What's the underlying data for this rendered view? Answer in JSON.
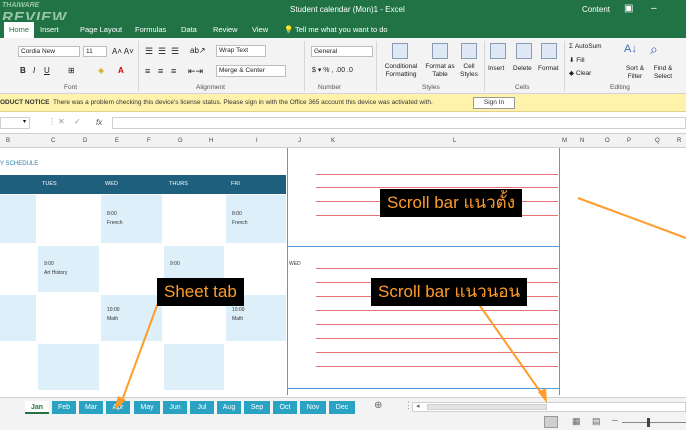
{
  "window": {
    "title": "Student calendar (Mon)1 - Excel",
    "content_label": "Content"
  },
  "watermark": {
    "line1": "THAIWARE",
    "line2": "REVIEW"
  },
  "ribbon_tabs": [
    "Home",
    "Insert",
    "Page Layout",
    "Formulas",
    "Data",
    "Review",
    "View"
  ],
  "tell_me": "Tell me what you want to do",
  "ribbon": {
    "font_name": "Cordia New",
    "font_size": "11",
    "wrap_text": "Wrap Text",
    "merge_center": "Merge & Center",
    "number_format": "General",
    "conditional_formatting": "Conditional Formatting",
    "format_as_table": "Format as Table",
    "cell_styles": "Cell Styles",
    "insert": "Insert",
    "delete": "Delete",
    "format": "Format",
    "autosum": "AutoSum",
    "fill": "Fill",
    "clear": "Clear",
    "sort_filter": "Sort & Filter",
    "find_select": "Find & Select",
    "groups": {
      "font": "Font",
      "alignment": "Alignment",
      "number": "Number",
      "styles": "Styles",
      "cells": "Cells",
      "editing": "Editing"
    }
  },
  "notice": {
    "title": "ODUCT NOTICE",
    "message": "There was a problem checking this device's license status. Please sign in with the Office 365 account this device was activated with.",
    "button": "Sign In"
  },
  "formula_bar": {
    "fx": "fx"
  },
  "columns": [
    "B",
    "C",
    "D",
    "E",
    "F",
    "G",
    "H",
    "I",
    "J",
    "K",
    "L",
    "M",
    "N",
    "O",
    "P",
    "Q",
    "R"
  ],
  "sheet": {
    "schedule_title": "Y SCHEDULE",
    "days": [
      "TUES",
      "WED",
      "THURS",
      "FRI"
    ],
    "entries": [
      {
        "time": "8:00",
        "subject": "French"
      },
      {
        "time": "8:00",
        "subject": "French"
      },
      {
        "time": "9:00",
        "subject": "Art History"
      },
      {
        "time": "9:00",
        "subject": ""
      },
      {
        "time": "10:00",
        "subject": "Math"
      },
      {
        "time": "10:00",
        "subject": "Math"
      }
    ],
    "notes_label": "WED"
  },
  "annotations": {
    "vertical_scroll": "Scroll bar แนวตั้ง",
    "sheet_tab": "Sheet tab",
    "horizontal_scroll": "Scroll bar แนวนอน"
  },
  "annotation_color": "#ff9c2a",
  "sheet_tabs": [
    "Jan",
    "Feb",
    "Mar",
    "Apr",
    "May",
    "Jun",
    "Jul",
    "Aug",
    "Sep",
    "Oct",
    "Nov",
    "Dec"
  ],
  "active_sheet": "Jan",
  "colors": {
    "excel_green": "#217346",
    "tab_blue": "#2aa3c2",
    "header_navy": "#1e5f7d",
    "notice_yellow": "#fff2ab"
  }
}
